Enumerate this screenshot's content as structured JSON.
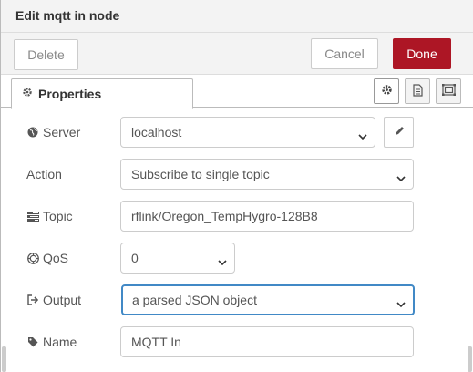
{
  "tray": {
    "title": "Edit mqtt in node"
  },
  "toolbar": {
    "delete_label": "Delete",
    "cancel_label": "Cancel",
    "done_label": "Done"
  },
  "tabs": {
    "properties_label": "Properties",
    "icons": [
      "gear-icon",
      "description-icon",
      "appearance-icon"
    ]
  },
  "form": {
    "server": {
      "label": "Server",
      "value": "localhost",
      "icon": "globe-icon"
    },
    "action": {
      "label": "Action",
      "value": "Subscribe to single topic"
    },
    "topic": {
      "label": "Topic",
      "value": "rflink/Oregon_TempHygro-128B8",
      "icon": "tasks-icon"
    },
    "qos": {
      "label": "QoS",
      "value": "0",
      "icon": "empire-icon"
    },
    "output": {
      "label": "Output",
      "value": "a parsed JSON object",
      "icon": "sign-out-icon"
    },
    "name": {
      "label": "Name",
      "value": "MQTT In",
      "icon": "tag-icon"
    }
  },
  "colors": {
    "done_button": "#ad1625",
    "focus_border": "#4189c6"
  }
}
